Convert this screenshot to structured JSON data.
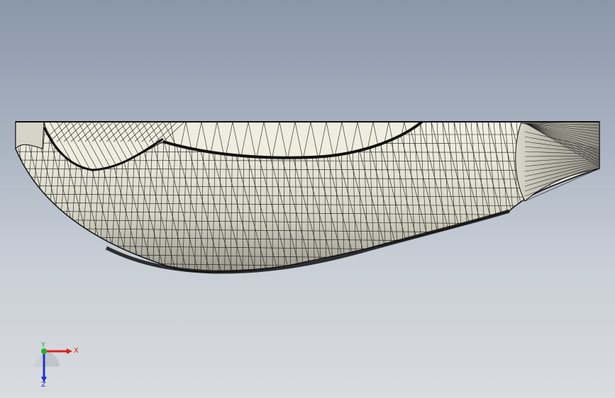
{
  "viewport": {
    "background_top": "#8a97ab",
    "background_bottom": "#d9dcdf"
  },
  "model": {
    "name": "mesh-part",
    "face_color": "#e4e2d4",
    "face_shade": "#c9c7b8",
    "edge_color": "#111111"
  },
  "triad": {
    "x_label": "X",
    "y_label": "Y",
    "z_label": "Z",
    "x_color": "#e02020",
    "y_color": "#20b030",
    "z_color": "#2030d0"
  }
}
